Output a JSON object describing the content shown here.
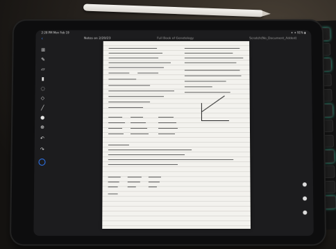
{
  "status_bar": {
    "time": "2:28 PM  Mon Feb 19",
    "right": "✦ ✦ 91% ▮"
  },
  "nav_bar": {
    "left_title": "Notes on 2/20/23",
    "center_title": "Full Book of Genetology",
    "right_title": "Scratch(No_Document_Added)"
  },
  "tools": [
    "grid-icon",
    "pen-icon",
    "eraser-icon",
    "highlighter-icon",
    "lasso-icon",
    "shapes-icon",
    "brush-icon",
    "dot-icon",
    "add-icon",
    "undo-icon",
    "redo-icon"
  ],
  "colors": {
    "accent": "#2f7dff",
    "paper": "#f3f2ee"
  }
}
